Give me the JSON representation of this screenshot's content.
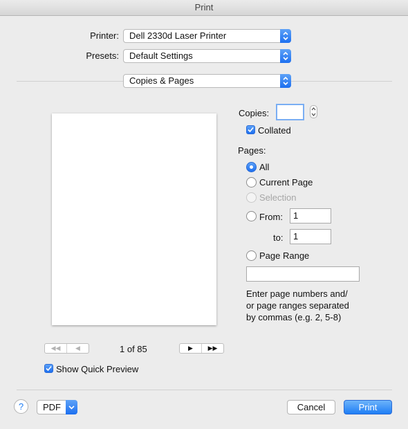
{
  "window": {
    "title": "Print"
  },
  "printer": {
    "label": "Printer:",
    "value": "Dell 2330d Laser Printer"
  },
  "presets": {
    "label": "Presets:",
    "value": "Default Settings"
  },
  "section": {
    "value": "Copies & Pages"
  },
  "copies": {
    "label": "Copies:",
    "value": ""
  },
  "collated": {
    "label": "Collated",
    "checked": true
  },
  "pages": {
    "label": "Pages:",
    "all": "All",
    "current_page": "Current Page",
    "selection": "Selection",
    "from_label": "From:",
    "from_value": "1",
    "to_label": "to:",
    "to_value": "1",
    "page_range": "Page Range",
    "page_range_value": "",
    "help_text_1": "Enter page numbers and/",
    "help_text_2": "or page ranges separated",
    "help_text_3": "by commas (e.g. 2, 5-8)"
  },
  "preview": {
    "page_indicator": "1 of 85",
    "first": "◀◀",
    "prev": "◀",
    "next": "▶",
    "last": "▶▶",
    "show_quick_preview": "Show Quick Preview"
  },
  "footer": {
    "help": "?",
    "pdf": "PDF",
    "cancel": "Cancel",
    "print": "Print"
  },
  "colors": {
    "accent": "#1f7ef5",
    "background": "#ececec"
  }
}
